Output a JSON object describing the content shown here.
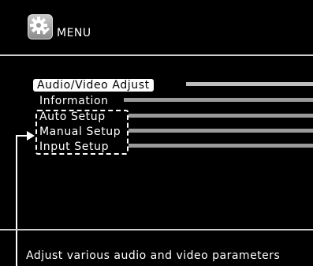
{
  "header": {
    "title": "MENU",
    "icon": "settings-gear-icon"
  },
  "menu": {
    "items": [
      {
        "label": "Audio/Video Adjust",
        "selected": true
      },
      {
        "label": "Information",
        "selected": false
      },
      {
        "label": "Auto Setup",
        "selected": false
      },
      {
        "label": "Manual Setup",
        "selected": false
      },
      {
        "label": "Input Setup",
        "selected": false
      }
    ]
  },
  "status": {
    "help_text": "Adjust various audio and video parameters"
  },
  "colors": {
    "background": "#000000",
    "highlight": "#ffffff",
    "leader": "#9a9a9a"
  }
}
